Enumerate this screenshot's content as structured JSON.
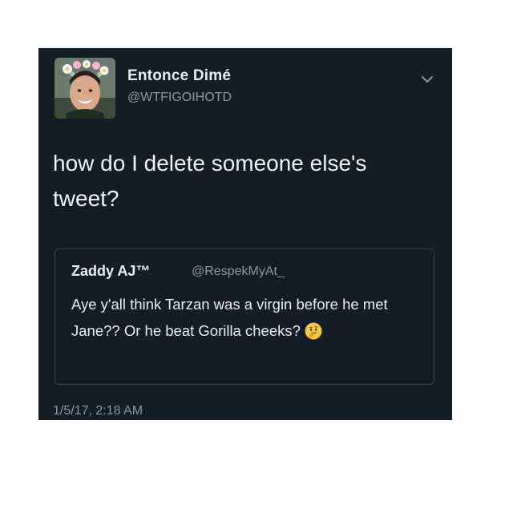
{
  "tweet": {
    "display_name": "Entonce Dimé",
    "handle": "@WTFIGOIHOTD",
    "avatar_icon": "user-avatar-flower-crown",
    "menu_icon": "chevron-down-icon",
    "text": "how do I delete someone else's tweet?",
    "timestamp": "1/5/17, 2:18 AM"
  },
  "quoted_tweet": {
    "display_name": "Zaddy AJ™",
    "handle": "@RespekMyAt_",
    "text": "Aye y'all think Tarzan was a virgin before he met Jane?? Or he beat Gorilla cheeks?",
    "emoji": "thinking-face-emoji"
  },
  "colors": {
    "card_background": "#141d26",
    "primary_text": "#e8edf2",
    "secondary_text": "#8899a6",
    "quote_border": "#3a4653"
  }
}
